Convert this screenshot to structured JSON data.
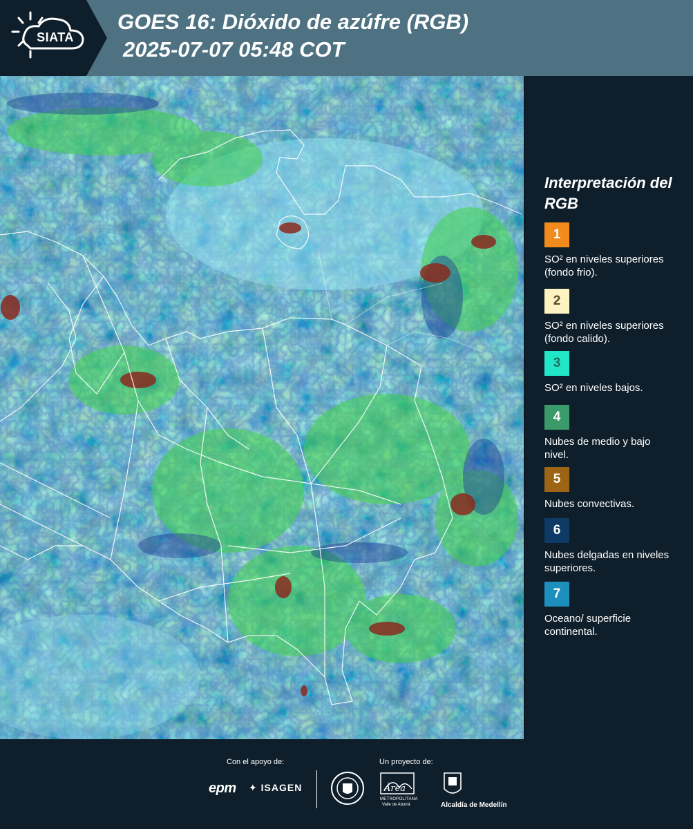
{
  "header": {
    "brand": "SIATA",
    "title_line1": "GOES 16: Dióxido de azúfre (RGB)",
    "title_line2": "2025-07-07 05:48 COT"
  },
  "legend": {
    "title": "Interpretación del RGB",
    "items": [
      {
        "number": "1",
        "color": "#f28a1c",
        "label": "SO² en niveles superiores (fondo frio)."
      },
      {
        "number": "2",
        "color": "#fdf3c0",
        "label": "SO² en niveles superiores (fondo calido)."
      },
      {
        "number": "3",
        "color": "#22e6c8",
        "label": "SO² en niveles bajos."
      },
      {
        "number": "4",
        "color": "#3a9a6a",
        "label": "Nubes de medio y bajo nivel."
      },
      {
        "number": "5",
        "color": "#9c6414",
        "label": "Nubes convectivas."
      },
      {
        "number": "6",
        "color": "#0f3a66",
        "label": "Nubes delgadas en niveles superiores."
      },
      {
        "number": "7",
        "color": "#1d8fbd",
        "label": "Oceano/ superficie continental."
      }
    ]
  },
  "footer": {
    "support_caption": "Con el apoyo de:",
    "project_caption": "Un proyecto de:",
    "sponsor1": "epm",
    "sponsor2": "ISAGEN",
    "partner_alcaldia": "Alcaldía de Medellín",
    "partner_area_line1": "METROPOLITANA",
    "partner_area_line2": "Valle de Aburrá",
    "partner_area_script": "Área"
  },
  "colors": {
    "header_bg": "#4e7282",
    "page_bg": "#0e1f2b",
    "ocean": "#3fb5d0",
    "cloud_green": "#3fcf4a",
    "cloud_dark_blue": "#1a3c8c",
    "convective_red": "#8a2a1e",
    "border_white": "#ffffff"
  }
}
